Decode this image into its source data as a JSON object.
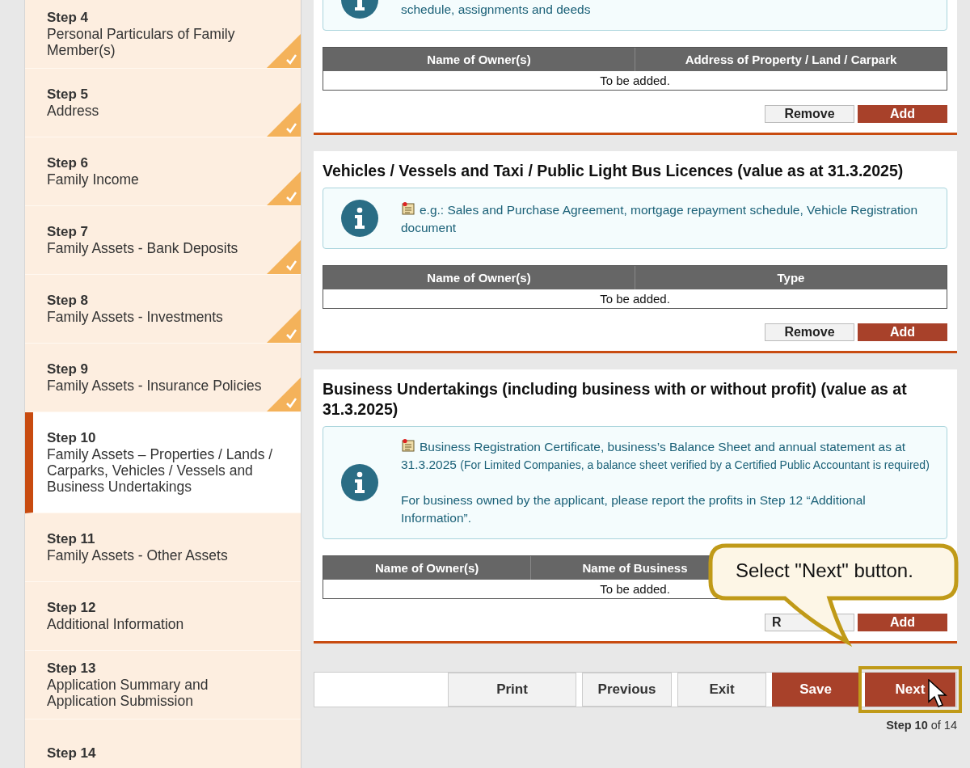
{
  "sidebar": {
    "steps": [
      {
        "step": "Step 4",
        "title": "Personal Particulars of Family Member(s)",
        "completed": true,
        "selected": false
      },
      {
        "step": "Step 5",
        "title": "Address",
        "completed": true,
        "selected": false
      },
      {
        "step": "Step 6",
        "title": "Family Income",
        "completed": true,
        "selected": false
      },
      {
        "step": "Step 7",
        "title": "Family Assets - Bank Deposits",
        "completed": true,
        "selected": false
      },
      {
        "step": "Step 8",
        "title": "Family Assets - Investments",
        "completed": true,
        "selected": false
      },
      {
        "step": "Step 9",
        "title": "Family Assets - Insurance Policies",
        "completed": true,
        "selected": false
      },
      {
        "step": "Step 10",
        "title": "Family Assets – Properties / Lands / Carparks, Vehicles / Vessels and Business Undertakings",
        "completed": false,
        "selected": true
      },
      {
        "step": "Step 11",
        "title": "Family Assets - Other Assets",
        "completed": false,
        "selected": false
      },
      {
        "step": "Step 12",
        "title": "Additional Information",
        "completed": false,
        "selected": false
      },
      {
        "step": "Step 13",
        "title": "Application Summary and Application Submission",
        "completed": false,
        "selected": false
      },
      {
        "step": "Step 14",
        "completed": false,
        "selected": false
      }
    ]
  },
  "sections": [
    {
      "info": [
        {
          "text": "schedule, assignments and deeds",
          "note_icon": false
        }
      ],
      "table": {
        "columns": [
          "Name of Owner(s)",
          "Address of Property / Land / Carpark"
        ],
        "covered_column": false,
        "empty_text": "To be added."
      },
      "remove": {
        "label": "Remove",
        "covered": false
      },
      "add": "Add"
    },
    {
      "heading": "Vehicles / Vessels and Taxi / Public Light Bus Licences (value as at 31.3.2025)",
      "info": [
        {
          "text": "e.g.: Sales and Purchase Agreement, mortgage repayment schedule, Vehicle Registration document",
          "note_icon": true
        }
      ],
      "table": {
        "columns": [
          "Name of Owner(s)",
          "Type"
        ],
        "covered_column": false,
        "empty_text": "To be added."
      },
      "remove": {
        "label": "Remove",
        "covered": false
      },
      "add": "Add"
    },
    {
      "heading": "Business Undertakings (including business with or without profit) (value as at 31.3.2025)",
      "info": [
        {
          "text": "Business Registration Certificate, business’s Balance Sheet and annual statement as at 31.3.2025",
          "small_text": "(For Limited Companies, a balance sheet verified by a Certified Public Accountant is required)",
          "note_icon": true
        },
        {
          "text": "For business owned by the applicant, please report the profits in Step 12 “Additional Information”.",
          "note_icon": false
        }
      ],
      "table": {
        "columns": [
          "Name of Owner(s)",
          "Name of Business"
        ],
        "covered_column": true,
        "empty_text": "To be added."
      },
      "remove": {
        "label": "R",
        "covered": true
      },
      "add": "Add"
    }
  ],
  "nav": {
    "buttons": [
      {
        "label": "Print",
        "kind": "plain",
        "highlighted": false
      },
      {
        "label": "Previous",
        "kind": "plain",
        "highlighted": false
      },
      {
        "label": "Exit",
        "kind": "plain",
        "highlighted": false
      },
      {
        "label": "Save",
        "kind": "primary",
        "highlighted": false
      },
      {
        "label": "Next",
        "kind": "primary",
        "highlighted": true
      }
    ],
    "progress": "**Step 10** of 14"
  },
  "callout": {
    "text": "Select \"Next\" button."
  }
}
